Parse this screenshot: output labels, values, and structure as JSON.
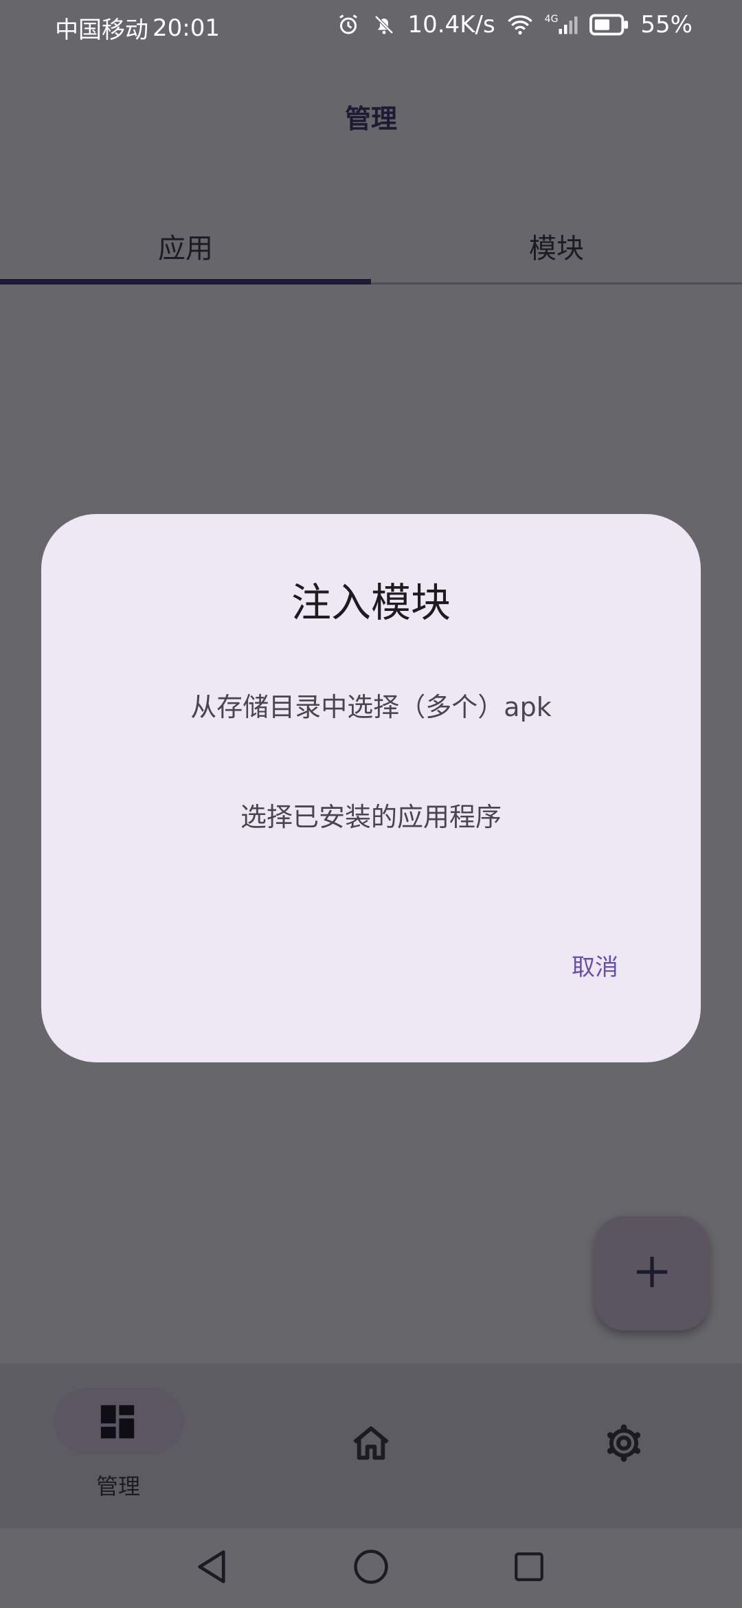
{
  "status_bar": {
    "carrier": "中国移动",
    "time": "20:01",
    "net_speed": "10.4K/s",
    "network_type": "4G",
    "battery": "55%"
  },
  "header": {
    "title": "管理"
  },
  "tabs": [
    {
      "label": "应用",
      "selected": true
    },
    {
      "label": "模块",
      "selected": false
    }
  ],
  "dialog": {
    "title": "注入模块",
    "options": [
      "从存储目录中选择（多个）apk",
      "选择已安装的应用程序"
    ],
    "cancel_label": "取消"
  },
  "fab": {
    "icon": "plus-icon"
  },
  "bottom_nav": {
    "items": [
      {
        "label": "管理",
        "icon": "dashboard-icon",
        "selected": true
      },
      {
        "icon": "home-icon",
        "selected": false
      },
      {
        "icon": "gear-icon",
        "selected": false
      }
    ]
  },
  "system_nav": {
    "icons": [
      "back-icon",
      "home-circle-icon",
      "recents-icon"
    ]
  },
  "colors": {
    "scrim_background": "#67666b",
    "dialog_background": "#eee8f4",
    "accent": "#6750a4",
    "tab_indicator": "#1e1a35"
  }
}
